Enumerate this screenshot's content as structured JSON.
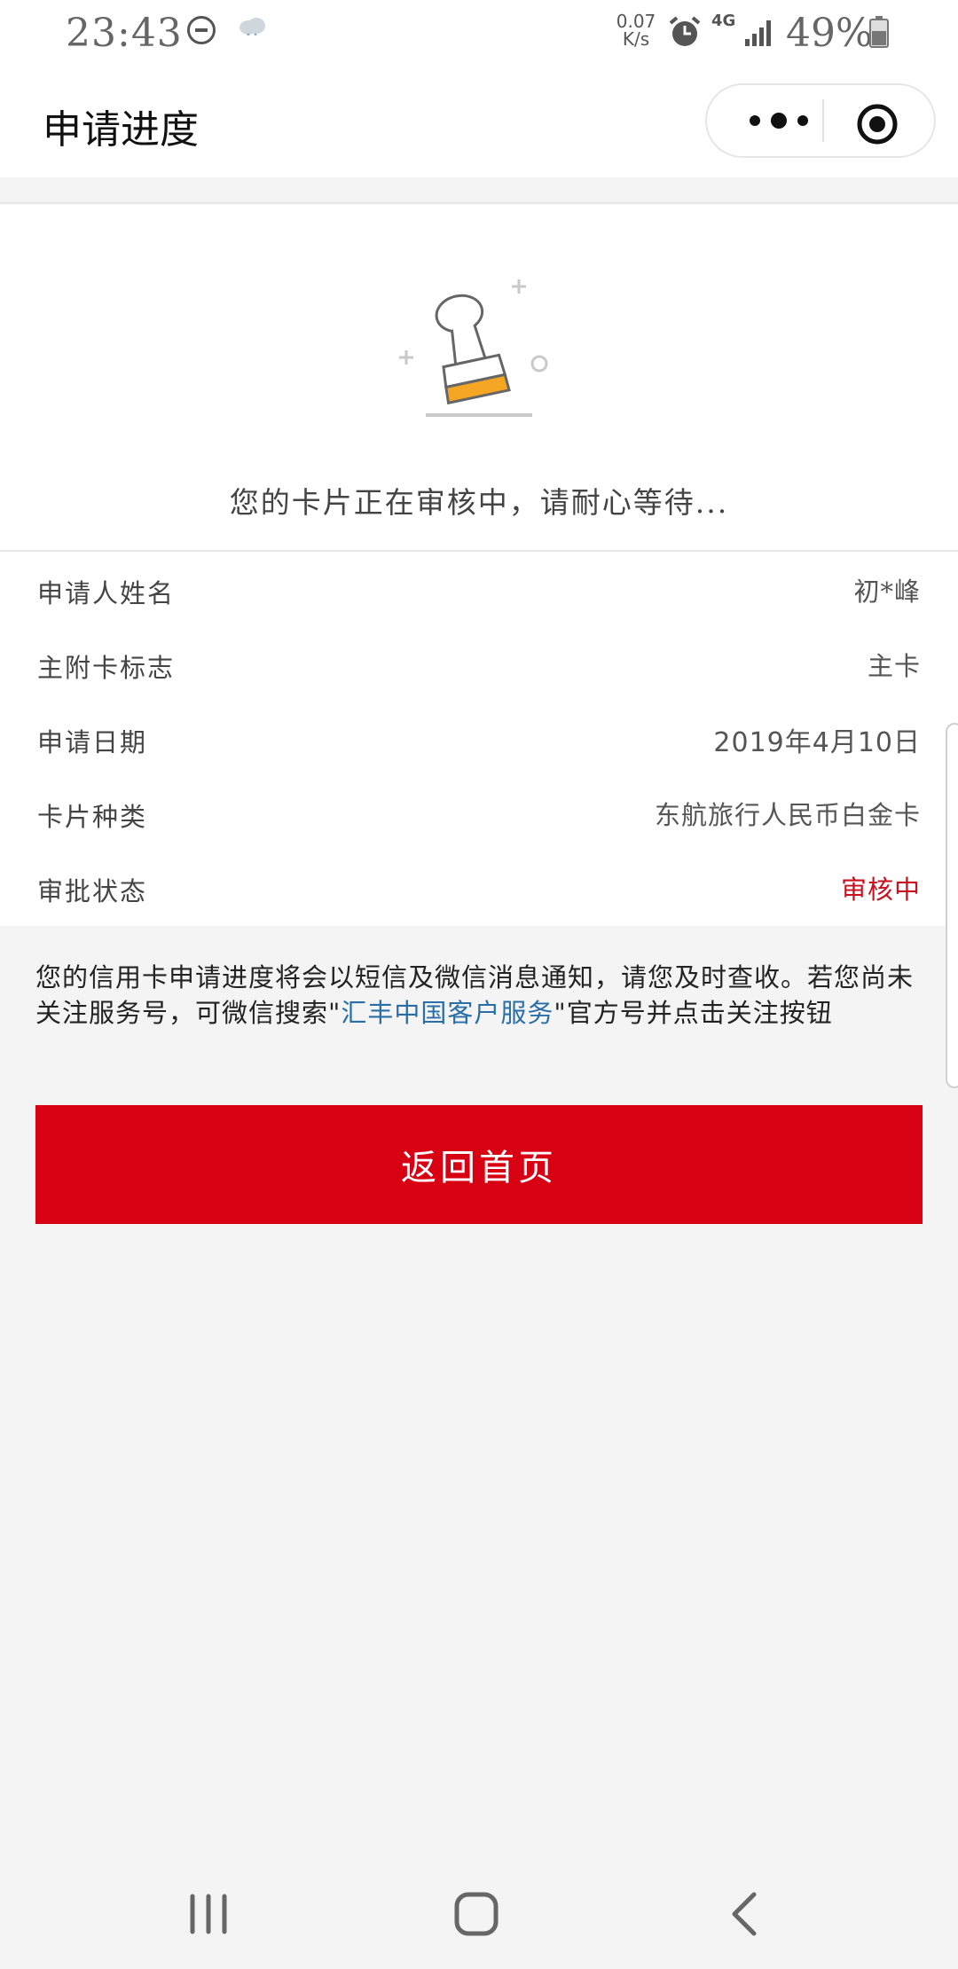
{
  "status_bar": {
    "time": "23:43",
    "speed": "0.07 K/s",
    "network": "4G",
    "battery": "49%",
    "icons": [
      "dnd-icon",
      "cloud-icon",
      "alarm-icon",
      "signal-icon",
      "battery-icon"
    ]
  },
  "navbar": {
    "title": "申请进度",
    "icons": [
      "more-icon",
      "target-icon"
    ]
  },
  "hero": {
    "icon": "stamp-icon",
    "message": "您的卡片正在审核中，请耐心等待..."
  },
  "info_rows": [
    {
      "label": "申请人姓名",
      "value": "初*峰"
    },
    {
      "label": "主附卡标志",
      "value": "主卡"
    },
    {
      "label": "申请日期",
      "value": "2019年4月10日"
    },
    {
      "label": "卡片种类",
      "value": "东航旅行人民币白金卡"
    },
    {
      "label": "审批状态",
      "value": "审核中"
    }
  ],
  "notice": {
    "text_before": "您的信用卡申请进度将会以短信及微信消息通知，请您及时查收。若您尚未关注服务号，可微信搜索\"",
    "link": "汇丰中国客户服务",
    "text_after": "\"官方号并点击关注按钮"
  },
  "home_button_label": "返回首页",
  "colors": {
    "accent_red": "#d80013",
    "status_red": "#c8101e",
    "link_blue": "#2a6ea8",
    "page_bg": "#f4f4f5"
  },
  "system_nav": [
    "recent-apps-icon",
    "home-icon",
    "back-icon"
  ]
}
